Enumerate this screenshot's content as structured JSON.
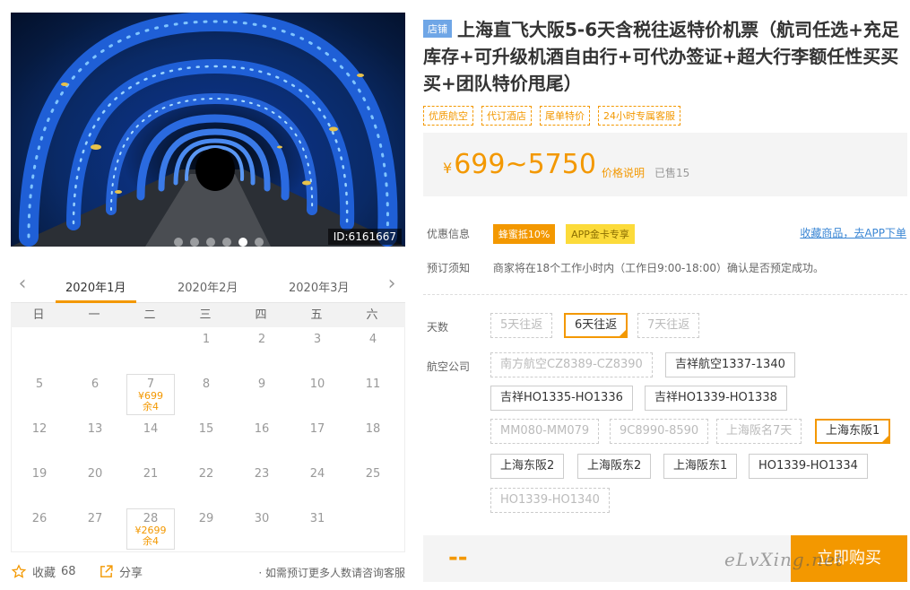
{
  "gallery": {
    "image_id": "ID:6161667",
    "dots": 6,
    "active_dot": 5
  },
  "calendar": {
    "months": [
      "2020年1月",
      "2020年2月",
      "2020年3月"
    ],
    "weekdays": [
      "日",
      "一",
      "二",
      "三",
      "四",
      "五",
      "六"
    ],
    "weeks": [
      [
        {
          "d": ""
        },
        {
          "d": ""
        },
        {
          "d": ""
        },
        {
          "d": "1"
        },
        {
          "d": "2"
        },
        {
          "d": "3"
        },
        {
          "d": "4"
        }
      ],
      [
        {
          "d": "5"
        },
        {
          "d": "6"
        },
        {
          "d": "7",
          "price": "¥699",
          "rest": "余4"
        },
        {
          "d": "8"
        },
        {
          "d": "9"
        },
        {
          "d": "10"
        },
        {
          "d": "11"
        }
      ],
      [
        {
          "d": "12"
        },
        {
          "d": "13"
        },
        {
          "d": "14"
        },
        {
          "d": "15"
        },
        {
          "d": "16"
        },
        {
          "d": "17"
        },
        {
          "d": "18"
        }
      ],
      [
        {
          "d": "19"
        },
        {
          "d": "20"
        },
        {
          "d": "21"
        },
        {
          "d": "22"
        },
        {
          "d": "23"
        },
        {
          "d": "24"
        },
        {
          "d": "25"
        }
      ],
      [
        {
          "d": "26"
        },
        {
          "d": "27"
        },
        {
          "d": "28",
          "price": "¥2699",
          "rest": "余4"
        },
        {
          "d": "29"
        },
        {
          "d": "30"
        },
        {
          "d": "31"
        },
        {
          "d": ""
        }
      ]
    ]
  },
  "actions": {
    "favorite_label": "收藏",
    "favorite_count": "68",
    "share_label": "分享",
    "hint": "· 如需预订更多人数请咨询客服"
  },
  "product": {
    "shop_tag": "店铺",
    "title": "上海直飞大阪5-6天含税往返特价机票（航司任选+充足库存+可升级机酒自由行+可代办签证+超大行李额任性买买买+团队特价甩尾）",
    "tags": [
      "优质航空",
      "代订酒店",
      "尾单特价",
      "24小时专属客服"
    ],
    "price_yen": "¥",
    "price_range": "699~5750",
    "price_note": "价格说明",
    "sold": "已售15"
  },
  "promo": {
    "label": "优惠信息",
    "badge1": "蜂蜜抵10%",
    "badge2": "APP金卡专享",
    "app_link": "收藏商品，去APP下单"
  },
  "notice": {
    "label": "预订须知",
    "text": "商家将在18个工作小时内（工作日9:00-18:00）确认是否预定成功。"
  },
  "options": {
    "days_label": "天数",
    "days": [
      "5天往返",
      "6天往返",
      "7天往返"
    ],
    "airline_label": "航空公司",
    "airlines": [
      "南方航空CZ8389-CZ8390",
      "吉祥航空1337-1340",
      "吉祥HO1335-HO1336",
      "吉祥HO1339-HO1338",
      "MM080-MM079",
      "9C8990-8590",
      "上海阪名7天",
      "上海东阪1",
      "上海东阪2",
      "上海阪东2",
      "上海阪东1",
      "HO1339-HO1334",
      "HO1339-HO1340"
    ]
  },
  "buy": {
    "amount": "--",
    "button": "立即购买"
  },
  "watermark": "eLvXing.net",
  "colors": {
    "accent": "#f39800",
    "link": "#3a86d4",
    "shop_tag": "#6fa6e6",
    "promo_yellow": "#fcdb3a"
  }
}
